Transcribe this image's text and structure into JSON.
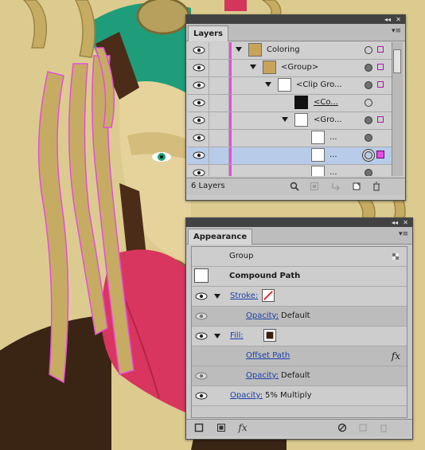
{
  "layers_panel": {
    "tab_label": "Layers",
    "collapse_glyph": "◂◂",
    "close_glyph": "✕",
    "menu_glyph": "▾≡",
    "rows": [
      {
        "name": "Coloring"
      },
      {
        "name": "<Group>"
      },
      {
        "name": "<Clip Gro..."
      },
      {
        "name": "<Co..."
      },
      {
        "name": "<Gro..."
      },
      {
        "name": "..."
      },
      {
        "name": "..."
      },
      {
        "name": "..."
      }
    ],
    "footer_count": "6 Layers",
    "footer_icons": [
      "search-icon",
      "make-clip-mask-icon",
      "new-sublayer-icon",
      "new-layer-icon",
      "delete-icon"
    ]
  },
  "appearance_panel": {
    "tab_label": "Appearance",
    "collapse_glyph": "◂◂",
    "close_glyph": "✕",
    "menu_glyph": "▾≡",
    "group_label": "Group",
    "object_label": "Compound Path",
    "stroke_label": "Stroke:",
    "stroke_opacity_label": "Opacity:",
    "stroke_opacity_value": "Default",
    "fill_label": "Fill:",
    "effect_label": "Offset Path",
    "effect_icon_glyph": "fx",
    "fill_opacity_label": "Opacity:",
    "fill_opacity_value": "Default",
    "object_opacity_label": "Opacity:",
    "object_opacity_value": "5% Multiply",
    "footer_fx_glyph": "fx"
  },
  "colors": {
    "canvas_bg": "#dccb8f",
    "layer_color": "#e54ce1",
    "selection_row": "#b8cbe8",
    "link_blue": "#1a3fa8"
  }
}
